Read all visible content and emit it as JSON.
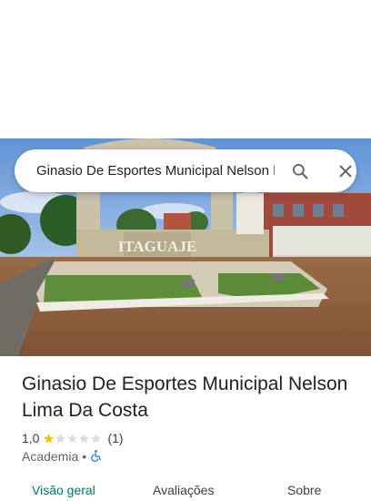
{
  "search": {
    "query": "Ginasio De Esportes Municipal Nelson Lima Da Costa"
  },
  "photo": {
    "sign_text": "ITAGUAJE",
    "description_icon": "place-photo"
  },
  "place": {
    "title": "Ginasio De Esportes Municipal Nelson Lima Da Costa",
    "rating": "1,0",
    "rating_value": 1,
    "rating_max": 5,
    "review_count": "(1)",
    "category": "Academia",
    "separator": "•",
    "accessibility_icon": "wheelchair-icon"
  },
  "tabs": [
    {
      "label": "Visão geral",
      "active": true
    },
    {
      "label": "Avaliações",
      "active": false
    },
    {
      "label": "Sobre",
      "active": false
    }
  ],
  "colors": {
    "star_filled": "#fbbc04",
    "star_empty": "#dadce0",
    "accent": "#00796b",
    "accessibility": "#1a73e8"
  }
}
